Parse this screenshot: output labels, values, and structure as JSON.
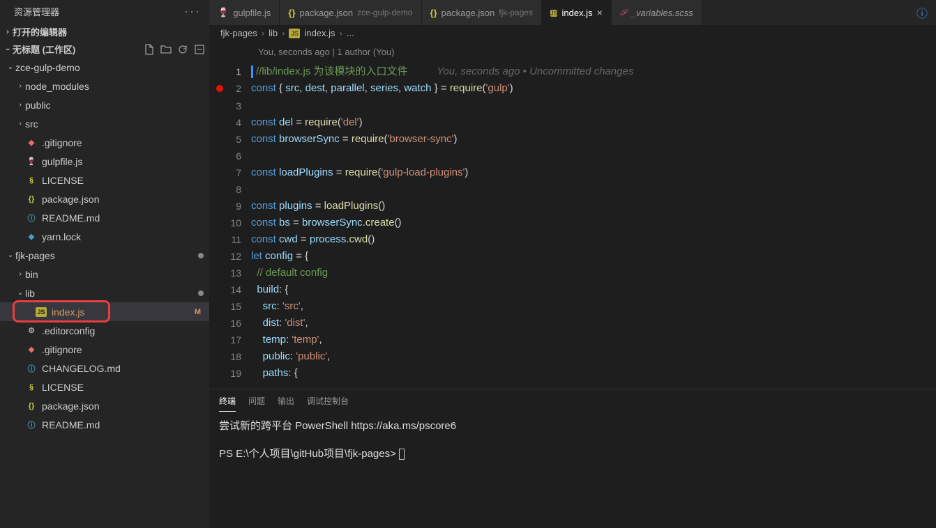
{
  "sidebar": {
    "title": "资源管理器",
    "openEditors": "打开的编辑器",
    "workspace": "无标题 (工作区)",
    "tree": [
      {
        "type": "folder",
        "depth": 0,
        "label": "zce-gulp-demo",
        "open": true
      },
      {
        "type": "folder",
        "depth": 1,
        "label": "node_modules",
        "open": false
      },
      {
        "type": "folder",
        "depth": 1,
        "label": "public",
        "open": false
      },
      {
        "type": "folder",
        "depth": 1,
        "label": "src",
        "open": false
      },
      {
        "type": "file",
        "depth": 1,
        "label": ".gitignore",
        "icon": "git"
      },
      {
        "type": "file",
        "depth": 1,
        "label": "gulpfile.js",
        "icon": "gulp"
      },
      {
        "type": "file",
        "depth": 1,
        "label": "LICENSE",
        "icon": "lic"
      },
      {
        "type": "file",
        "depth": 1,
        "label": "package.json",
        "icon": "json"
      },
      {
        "type": "file",
        "depth": 1,
        "label": "README.md",
        "icon": "md"
      },
      {
        "type": "file",
        "depth": 1,
        "label": "yarn.lock",
        "icon": "yarn"
      },
      {
        "type": "folder",
        "depth": 0,
        "label": "fjk-pages",
        "open": true,
        "dot": true
      },
      {
        "type": "folder",
        "depth": 1,
        "label": "bin",
        "open": false
      },
      {
        "type": "folder",
        "depth": 1,
        "label": "lib",
        "open": true,
        "dot": true
      },
      {
        "type": "file",
        "depth": 2,
        "label": "index.js",
        "icon": "js",
        "active": true,
        "badge": "M",
        "hl": true
      },
      {
        "type": "file",
        "depth": 1,
        "label": ".editorconfig",
        "icon": "gear"
      },
      {
        "type": "file",
        "depth": 1,
        "label": ".gitignore",
        "icon": "git"
      },
      {
        "type": "file",
        "depth": 1,
        "label": "CHANGELOG.md",
        "icon": "md"
      },
      {
        "type": "file",
        "depth": 1,
        "label": "LICENSE",
        "icon": "lic"
      },
      {
        "type": "file",
        "depth": 1,
        "label": "package.json",
        "icon": "json"
      },
      {
        "type": "file",
        "depth": 1,
        "label": "README.md",
        "icon": "md"
      }
    ]
  },
  "tabs": [
    {
      "label": "gulpfile.js",
      "icon": "gulp"
    },
    {
      "label": "package.json",
      "dim": "zce-gulp-demo",
      "icon": "json"
    },
    {
      "label": "package.json",
      "dim": "fjk-pages",
      "icon": "json"
    },
    {
      "label": "index.js",
      "icon": "js",
      "active": true,
      "close": true
    },
    {
      "label": "_variables.scss",
      "icon": "scss",
      "italic": true
    }
  ],
  "breadcrumb": {
    "parts": [
      "fjk-pages",
      "lib"
    ],
    "fileIcon": "js",
    "file": "index.js",
    "tail": "..."
  },
  "codelens": "You, seconds ago | 1 author (You)",
  "blame": "You, seconds ago • Uncommitted changes",
  "code": {
    "l1": "//lib/index.js 为该模块的入口文件",
    "l2a": "const",
    "l2b": " { ",
    "l2c": "src",
    "l2d": ", ",
    "l2e": "dest",
    "l2f": ", ",
    "l2g": "parallel",
    "l2h": ", ",
    "l2i": "series",
    "l2j": ", ",
    "l2k": "watch",
    "l2l": " } = ",
    "l2m": "require",
    "l2n": "(",
    "l2o": "'gulp'",
    "l2p": ")",
    "l4a": "const",
    "l4b": " del",
    "l4c": " = ",
    "l4d": "require",
    "l4e": "(",
    "l4f": "'del'",
    "l4g": ")",
    "l5a": "const",
    "l5b": " browserSync",
    "l5c": " = ",
    "l5d": "require",
    "l5e": "(",
    "l5f": "'browser-sync'",
    "l5g": ")",
    "l7a": "const",
    "l7b": " loadPlugins",
    "l7c": " = ",
    "l7d": "require",
    "l7e": "(",
    "l7f": "'gulp-load-plugins'",
    "l7g": ")",
    "l9a": "const",
    "l9b": " plugins",
    "l9c": " = ",
    "l9d": "loadPlugins",
    "l9e": "()",
    "l10a": "const",
    "l10b": " bs",
    "l10c": " = ",
    "l10d": "browserSync",
    "l10e": ".",
    "l10f": "create",
    "l10g": "()",
    "l11a": "const",
    "l11b": " cwd",
    "l11c": " = ",
    "l11d": "process",
    "l11e": ".",
    "l11f": "cwd",
    "l11g": "()",
    "l12a": "let",
    "l12b": " config",
    "l12c": " = {",
    "l13": "  // default config",
    "l14a": "  ",
    "l14b": "build",
    "l14c": ": {",
    "l15a": "    ",
    "l15b": "src",
    "l15c": ": ",
    "l15d": "'src'",
    "l15e": ",",
    "l16a": "    ",
    "l16b": "dist",
    "l16c": ": ",
    "l16d": "'dist'",
    "l16e": ",",
    "l17a": "    ",
    "l17b": "temp",
    "l17c": ": ",
    "l17d": "'temp'",
    "l17e": ",",
    "l18a": "    ",
    "l18b": "public",
    "l18c": ": ",
    "l18d": "'public'",
    "l18e": ",",
    "l19a": "    ",
    "l19b": "paths",
    "l19c": ": {"
  },
  "panel": {
    "tabs": [
      "终端",
      "问题",
      "输出",
      "调试控制台"
    ],
    "line1": "尝试新的跨平台 PowerShell https://aka.ms/pscore6",
    "prompt": "PS E:\\个人项目\\gitHub项目\\fjk-pages> "
  }
}
